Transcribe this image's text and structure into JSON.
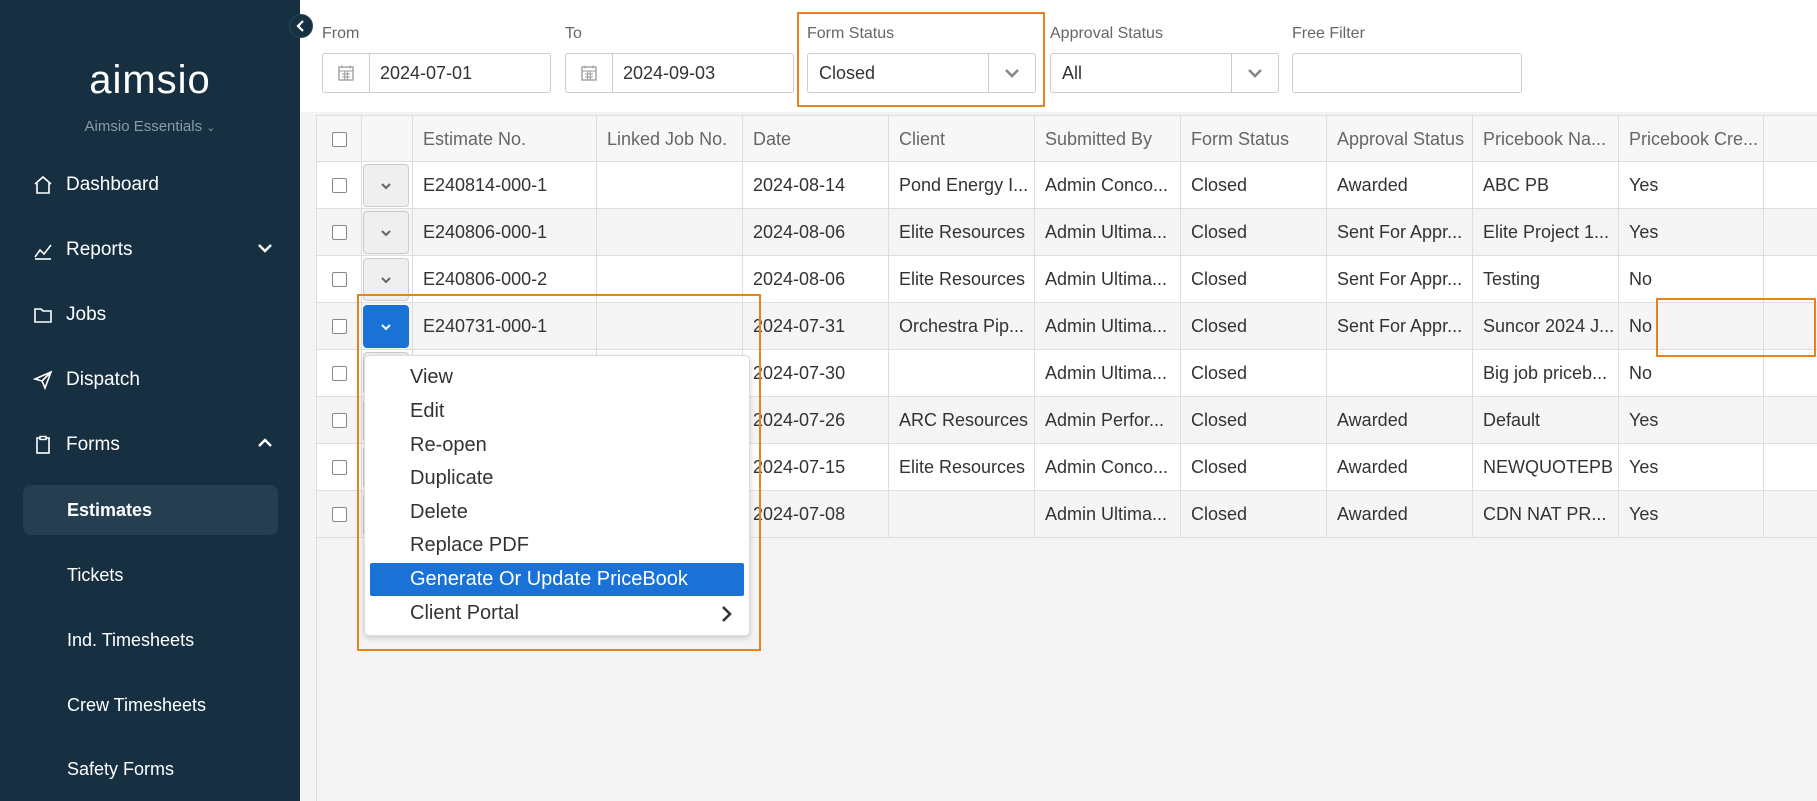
{
  "sidebar": {
    "logo": "aimsio",
    "workspace": "Aimsio Essentials",
    "nav": [
      {
        "label": "Dashboard",
        "icon": "home-icon"
      },
      {
        "label": "Reports",
        "icon": "chart-icon"
      },
      {
        "label": "Jobs",
        "icon": "folder-icon"
      },
      {
        "label": "Dispatch",
        "icon": "send-icon"
      },
      {
        "label": "Forms",
        "icon": "clipboard-icon"
      }
    ],
    "forms_sub": [
      "Estimates",
      "Tickets",
      "Ind. Timesheets",
      "Crew Timesheets",
      "Safety Forms"
    ]
  },
  "filters": {
    "from_label": "From",
    "from_value": "2024-07-01",
    "to_label": "To",
    "to_value": "2024-09-03",
    "form_status_label": "Form Status",
    "form_status_value": "Closed",
    "approval_status_label": "Approval Status",
    "approval_status_value": "All",
    "free_filter_label": "Free Filter",
    "free_filter_value": ""
  },
  "table": {
    "columns": [
      "Estimate No.",
      "Linked Job No.",
      "Date",
      "Client",
      "Submitted By",
      "Form Status",
      "Approval Status",
      "Pricebook Na...",
      "Pricebook Cre..."
    ],
    "rows": [
      [
        "E240814-000-1",
        "",
        "2024-08-14",
        "Pond Energy I...",
        "Admin Conco...",
        "Closed",
        "Awarded",
        "ABC PB",
        "Yes"
      ],
      [
        "E240806-000-1",
        "",
        "2024-08-06",
        "Elite Resources",
        "Admin Ultima...",
        "Closed",
        "Sent For Appr...",
        "Elite Project 1...",
        "Yes"
      ],
      [
        "E240806-000-2",
        "",
        "2024-08-06",
        "Elite Resources",
        "Admin Ultima...",
        "Closed",
        "Sent For Appr...",
        "Testing",
        "No"
      ],
      [
        "E240731-000-1",
        "",
        "2024-07-31",
        "Orchestra Pip...",
        "Admin Ultima...",
        "Closed",
        "Sent For Appr...",
        "Suncor 2024 J...",
        "No"
      ],
      [
        "",
        "",
        "2024-07-30",
        "",
        "Admin Ultima...",
        "Closed",
        "",
        "Big job priceb...",
        "No"
      ],
      [
        "",
        "",
        "2024-07-26",
        "ARC Resources",
        "Admin Perfor...",
        "Closed",
        "Awarded",
        "Default",
        "Yes"
      ],
      [
        "",
        "",
        "2024-07-15",
        "Elite Resources",
        "Admin Conco...",
        "Closed",
        "Awarded",
        "NEWQUOTEPB",
        "Yes"
      ],
      [
        "",
        "",
        "2024-07-08",
        "",
        "Admin Ultima...",
        "Closed",
        "Awarded",
        "CDN NAT PR...",
        "Yes"
      ]
    ]
  },
  "context_menu": {
    "items": [
      "View",
      "Edit",
      "Re-open",
      "Duplicate",
      "Delete",
      "Replace PDF",
      "Generate Or Update PriceBook",
      "Client Portal"
    ],
    "selected": "Generate Or Update PriceBook"
  },
  "colors": {
    "sidebar_bg": "#163042",
    "accent_blue": "#1b72d6",
    "highlight_orange": "#e8821a"
  }
}
